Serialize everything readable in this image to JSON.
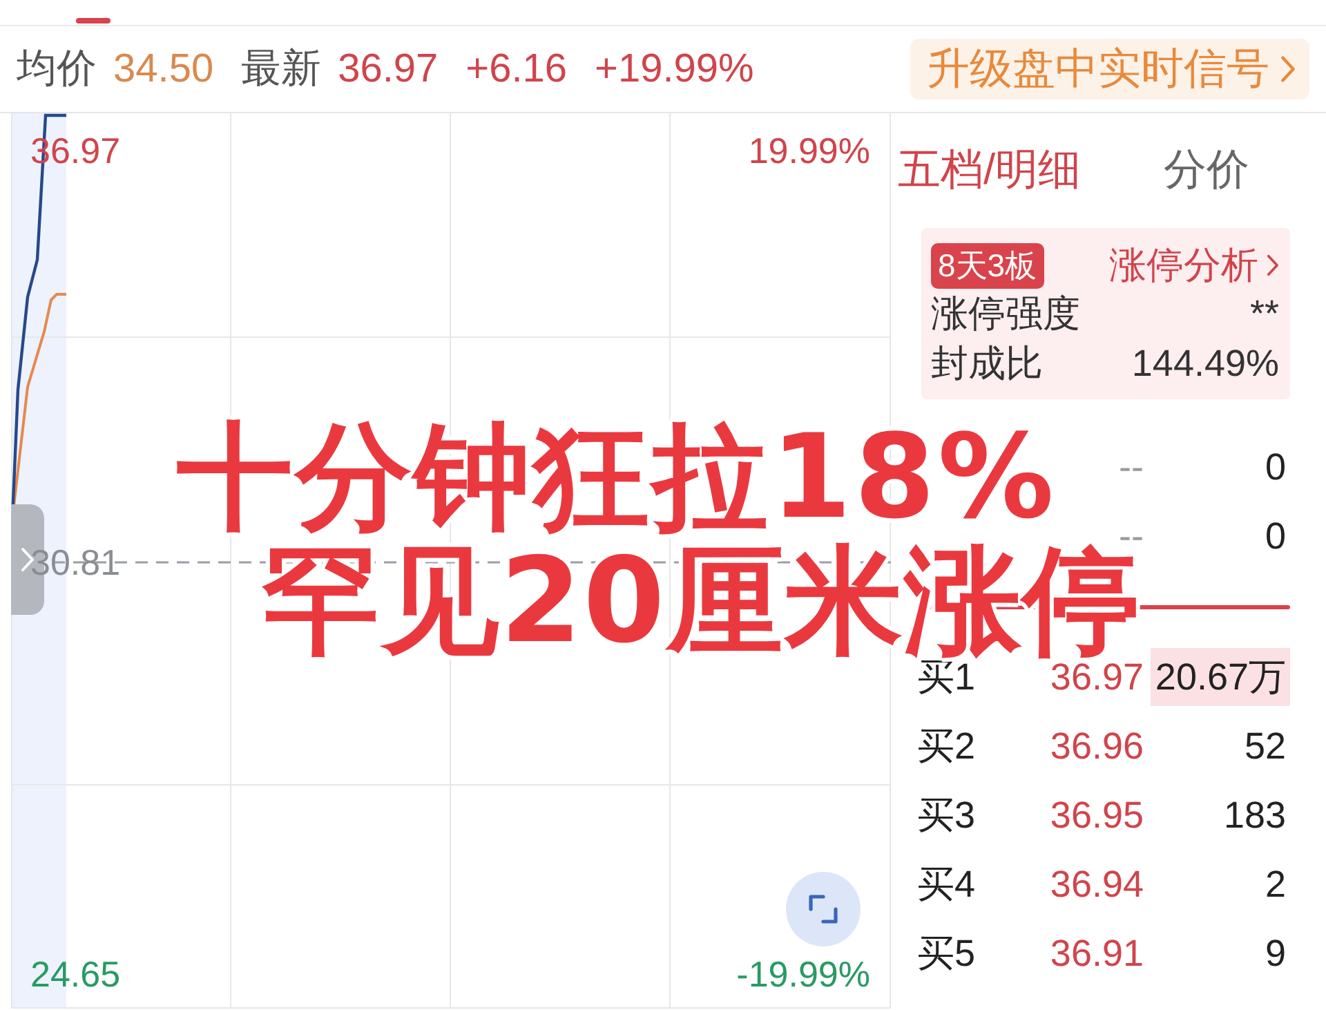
{
  "quote_bar": {
    "items": [
      {
        "label": "均价",
        "value": "34.50",
        "kind": "average"
      },
      {
        "label": "最新",
        "value": "36.97",
        "kind": "up"
      },
      {
        "value": "+6.16",
        "kind": "up"
      },
      {
        "value": "+19.99%",
        "kind": "up"
      }
    ]
  },
  "upgrade_button": {
    "label": "升级盘中实时信号"
  },
  "chart": {
    "price_labels": [
      {
        "text": "36.97",
        "kind": "up"
      },
      {
        "text": "30.81",
        "kind": "flat"
      },
      {
        "text": "24.65",
        "kind": "down"
      }
    ],
    "percent_labels": [
      {
        "text": "19.99%",
        "kind": "up"
      },
      {
        "text": "-19.99%",
        "kind": "down"
      }
    ]
  },
  "order_book": {
    "tabs": [
      {
        "label": "五档/明细",
        "selected": true
      },
      {
        "label": "分价",
        "selected": false
      }
    ],
    "limit_up_card": {
      "badge": "8天3板",
      "link": "涨停分析",
      "rows": [
        {
          "label": "涨停强度",
          "value": "**"
        },
        {
          "label": "封成比",
          "value": "144.49%"
        }
      ]
    },
    "asks": [
      {
        "price": "--",
        "volume": "0"
      },
      {
        "price": "--",
        "volume": "0"
      }
    ],
    "bids": [
      {
        "label": "买1",
        "price": "36.97",
        "volume": "20.67万",
        "highlighted": true
      },
      {
        "label": "买2",
        "price": "36.96",
        "volume": "52",
        "highlighted": false
      },
      {
        "label": "买3",
        "price": "36.95",
        "volume": "183",
        "highlighted": false
      },
      {
        "label": "买4",
        "price": "36.94",
        "volume": "2",
        "highlighted": false
      },
      {
        "label": "买5",
        "price": "36.91",
        "volume": "9",
        "highlighted": false
      }
    ]
  },
  "caption": {
    "lines": [
      "十分钟狂拉18%",
      "罕见20厘米涨停"
    ]
  }
}
